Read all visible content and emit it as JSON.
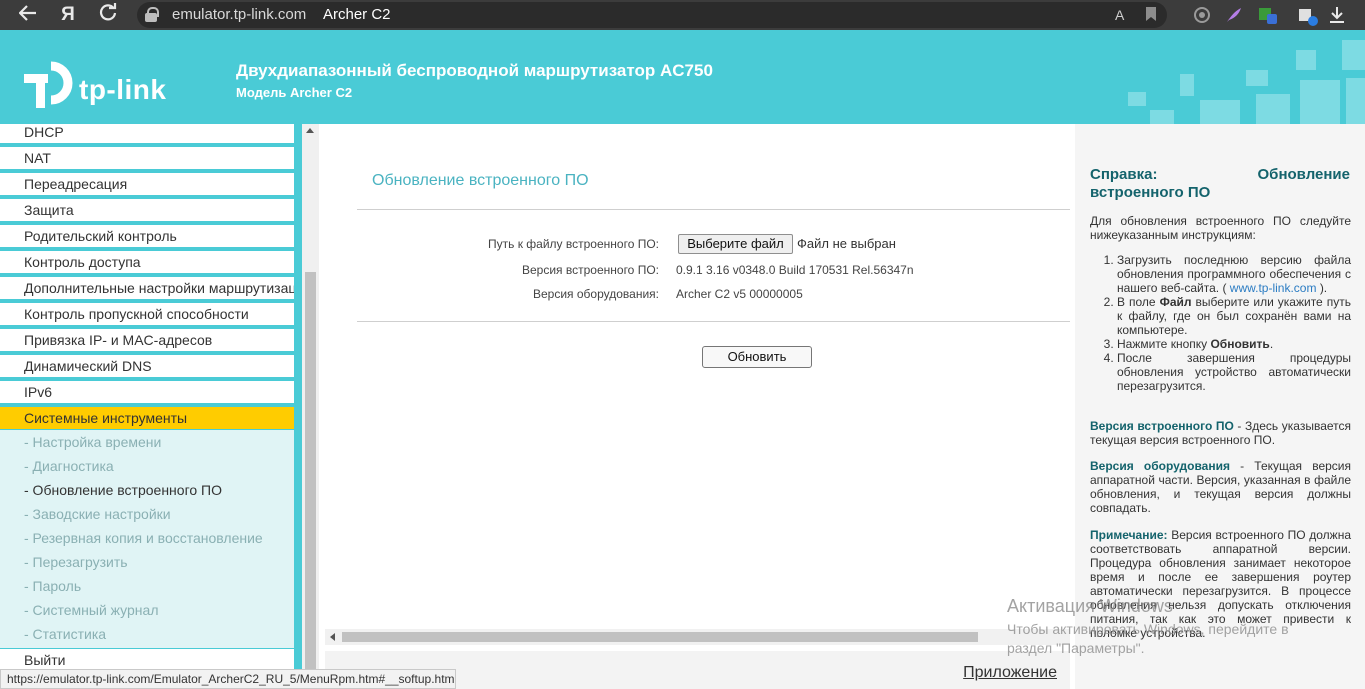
{
  "browser": {
    "url": "emulator.tp-link.com",
    "tab_title": "Archer C2",
    "yandex_glyph": "Я",
    "translate_glyph": "A",
    "colors": {
      "bar": "#3c3c3c"
    }
  },
  "header": {
    "logo_text": "tp-link",
    "title": "Двухдиапазонный беспроводной маршрутизатор AC750",
    "subtitle": "Модель Archer C2",
    "colors": {
      "brand": "#4acbd6"
    }
  },
  "sidebar": {
    "items": [
      {
        "label": "DHCP"
      },
      {
        "label": "NAT"
      },
      {
        "label": "Переадресация"
      },
      {
        "label": "Защита"
      },
      {
        "label": "Родительский контроль"
      },
      {
        "label": "Контроль доступа"
      },
      {
        "label": "Дополнительные настройки маршрутизации"
      },
      {
        "label": "Контроль пропускной способности"
      },
      {
        "label": "Привязка IP- и MAC-адресов"
      },
      {
        "label": "Динамический DNS"
      },
      {
        "label": "IPv6"
      },
      {
        "label": "Системные инструменты"
      }
    ],
    "subitems": [
      {
        "label": "- Настройка времени"
      },
      {
        "label": "- Диагностика"
      },
      {
        "label": "- Обновление встроенного ПО"
      },
      {
        "label": "- Заводские настройки"
      },
      {
        "label": "- Резервная копия и восстановление"
      },
      {
        "label": "- Перезагрузить"
      },
      {
        "label": "- Пароль"
      },
      {
        "label": "- Системный журнал"
      },
      {
        "label": "- Статистика"
      }
    ],
    "logout": "Выйти",
    "active_color": "#ffcc00"
  },
  "main": {
    "section_title": "Обновление встроенного ПО",
    "file_path_label": "Путь к файлу встроенного ПО:",
    "choose_file_button": "Выберите файл",
    "no_file_text": "Файл не выбран",
    "fw_version_label": "Версия встроенного ПО:",
    "fw_version_value": "0.9.1 3.16 v0348.0 Build 170531 Rel.56347n",
    "hw_version_label": "Версия оборудования:",
    "hw_version_value": "Archer C2 v5 00000005",
    "upgrade_button": "Обновить",
    "appendix_link": "Приложение"
  },
  "help": {
    "title_left": "Справка:",
    "title_left2": "встроенного ПО",
    "title_right": "Обновление",
    "intro": "Для обновления встроенного ПО следуйте нижеуказанным инструкциям:",
    "steps": [
      {
        "pre": "Загрузить последнюю версию файла обновления программного обеспечения с нашего веб-сайта. (",
        "link": " www.tp-link.com ",
        "post": ")."
      },
      {
        "pre": "В поле ",
        "bold": "Файл",
        "post": " выберите или укажите путь к файлу, где он был сохранён вами на компьютере."
      },
      {
        "pre": "Нажмите кнопку ",
        "bold": "Обновить",
        "post": "."
      },
      {
        "pre": "После завершения процедуры обновления устройство автоматически перезагрузится."
      }
    ],
    "fw_term": "Версия встроенного ПО",
    "fw_desc": " - Здесь указывается текущая версия встроенного ПО.",
    "hw_term": "Версия оборудования",
    "hw_desc": " - Текущая версия аппаратной части. Версия, указанная в файле обновления, и текущая версия должны совпадать.",
    "note_term": "Примечание:",
    "note_desc": " Версия встроенного ПО должна соответствовать аппаратной версии. Процедура обновления занимает некоторое время и после ее завершения роутер автоматически перезагрузится. В процессе обновления нельзя допускать отключения питания, так как это может привести к поломке устройства."
  },
  "watermark": {
    "line1": "Активация Windows",
    "line2": "Чтобы активировать Windows, перейдите в",
    "line3": "раздел \"Параметры\"."
  },
  "statusbar": {
    "url": "https://emulator.tp-link.com/Emulator_ArcherC2_RU_5/MenuRpm.htm#__softup.htm"
  }
}
